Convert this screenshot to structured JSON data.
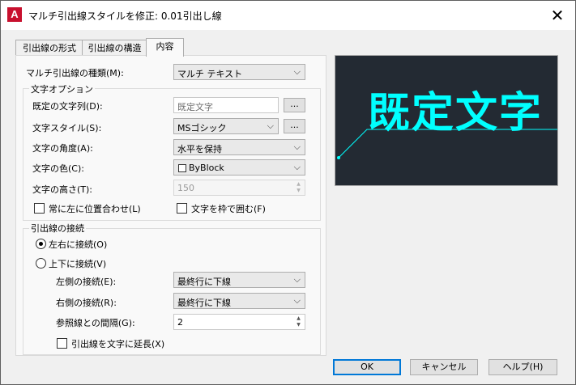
{
  "window": {
    "title": "マルチ引出線スタイルを修正: 0.01引出し線",
    "app_icon": "A"
  },
  "tabs": [
    {
      "label": "引出線の形式"
    },
    {
      "label": "引出線の構造"
    },
    {
      "label": "内容"
    }
  ],
  "content": {
    "multileader_type_label": "マルチ引出線の種類(M):",
    "multileader_type_value": "マルチ テキスト",
    "text_options_title": "文字オプション",
    "default_text_label": "既定の文字列(D):",
    "default_text_value": "既定文字",
    "ellipsis": "...",
    "text_style_label": "文字スタイル(S):",
    "text_style_value": "MSゴシック",
    "text_angle_label": "文字の角度(A):",
    "text_angle_value": "水平を保持",
    "text_color_label": "文字の色(C):",
    "text_color_value": "ByBlock",
    "text_height_label": "文字の高さ(T):",
    "text_height_value": "150",
    "always_left_label": "常に左に位置合わせ(L)",
    "frame_text_label": "文字を枠で囲む(F)",
    "leader_connection_title": "引出線の接続",
    "horizontal_attach_label": "左右に接続(O)",
    "vertical_attach_label": "上下に接続(V)",
    "left_attach_label": "左側の接続(E):",
    "left_attach_value": "最終行に下線",
    "right_attach_label": "右側の接続(R):",
    "right_attach_value": "最終行に下線",
    "landing_gap_label": "参照線との間隔(G):",
    "landing_gap_value": "2",
    "extend_leader_label": "引出線を文字に延長(X)"
  },
  "preview": {
    "text": "既定文字",
    "text_color": "#00FFFF",
    "background": "#232A33"
  },
  "buttons": {
    "ok": "OK",
    "cancel": "キャンセル",
    "help": "ヘルプ(H)"
  },
  "icons": {
    "close": "close-icon",
    "dropdown": "chevron-down-icon",
    "spin": "spin-arrows-icon"
  },
  "colors": {
    "accent": "#0078D7",
    "dialog_bg": "#F0F0F0"
  }
}
